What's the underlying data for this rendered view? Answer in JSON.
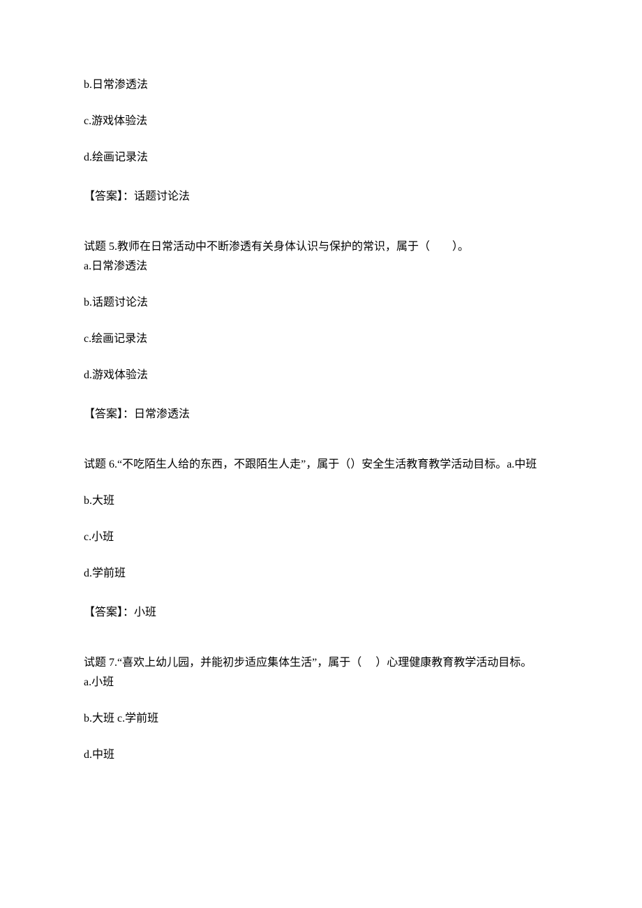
{
  "q4_partial": {
    "opt_b": "b.日常渗透法",
    "opt_c": "c.游戏体验法",
    "opt_d": "d.绘画记录法",
    "answer": "【答案】：话题讨论法"
  },
  "q5": {
    "stem": "试题 5.教师在日常活动中不断渗透有关身体认识与保护的常识，属于（        ）。",
    "opt_a": "a.日常渗透法",
    "opt_b": "b.话题讨论法",
    "opt_c": "c.绘画记录法",
    "opt_d": "d.游戏体验法",
    "answer": "【答案】：日常渗透法"
  },
  "q6": {
    "stem": "试题 6.“不吃陌生人给的东西，不跟陌生人走”，属于（）安全生活教育教学活动目标。a.中班",
    "opt_b": "b.大班",
    "opt_c": "c.小班",
    "opt_d": "d.学前班",
    "answer": "【答案】：小班"
  },
  "q7": {
    "stem": "试题 7.“喜欢上幼儿园，并能初步适应集体生活”，属于（     ）心理健康教育教学活动目标。",
    "opt_a": "a.小班",
    "opt_b": "b.大班 c.学前班",
    "opt_d": "d.中班"
  }
}
